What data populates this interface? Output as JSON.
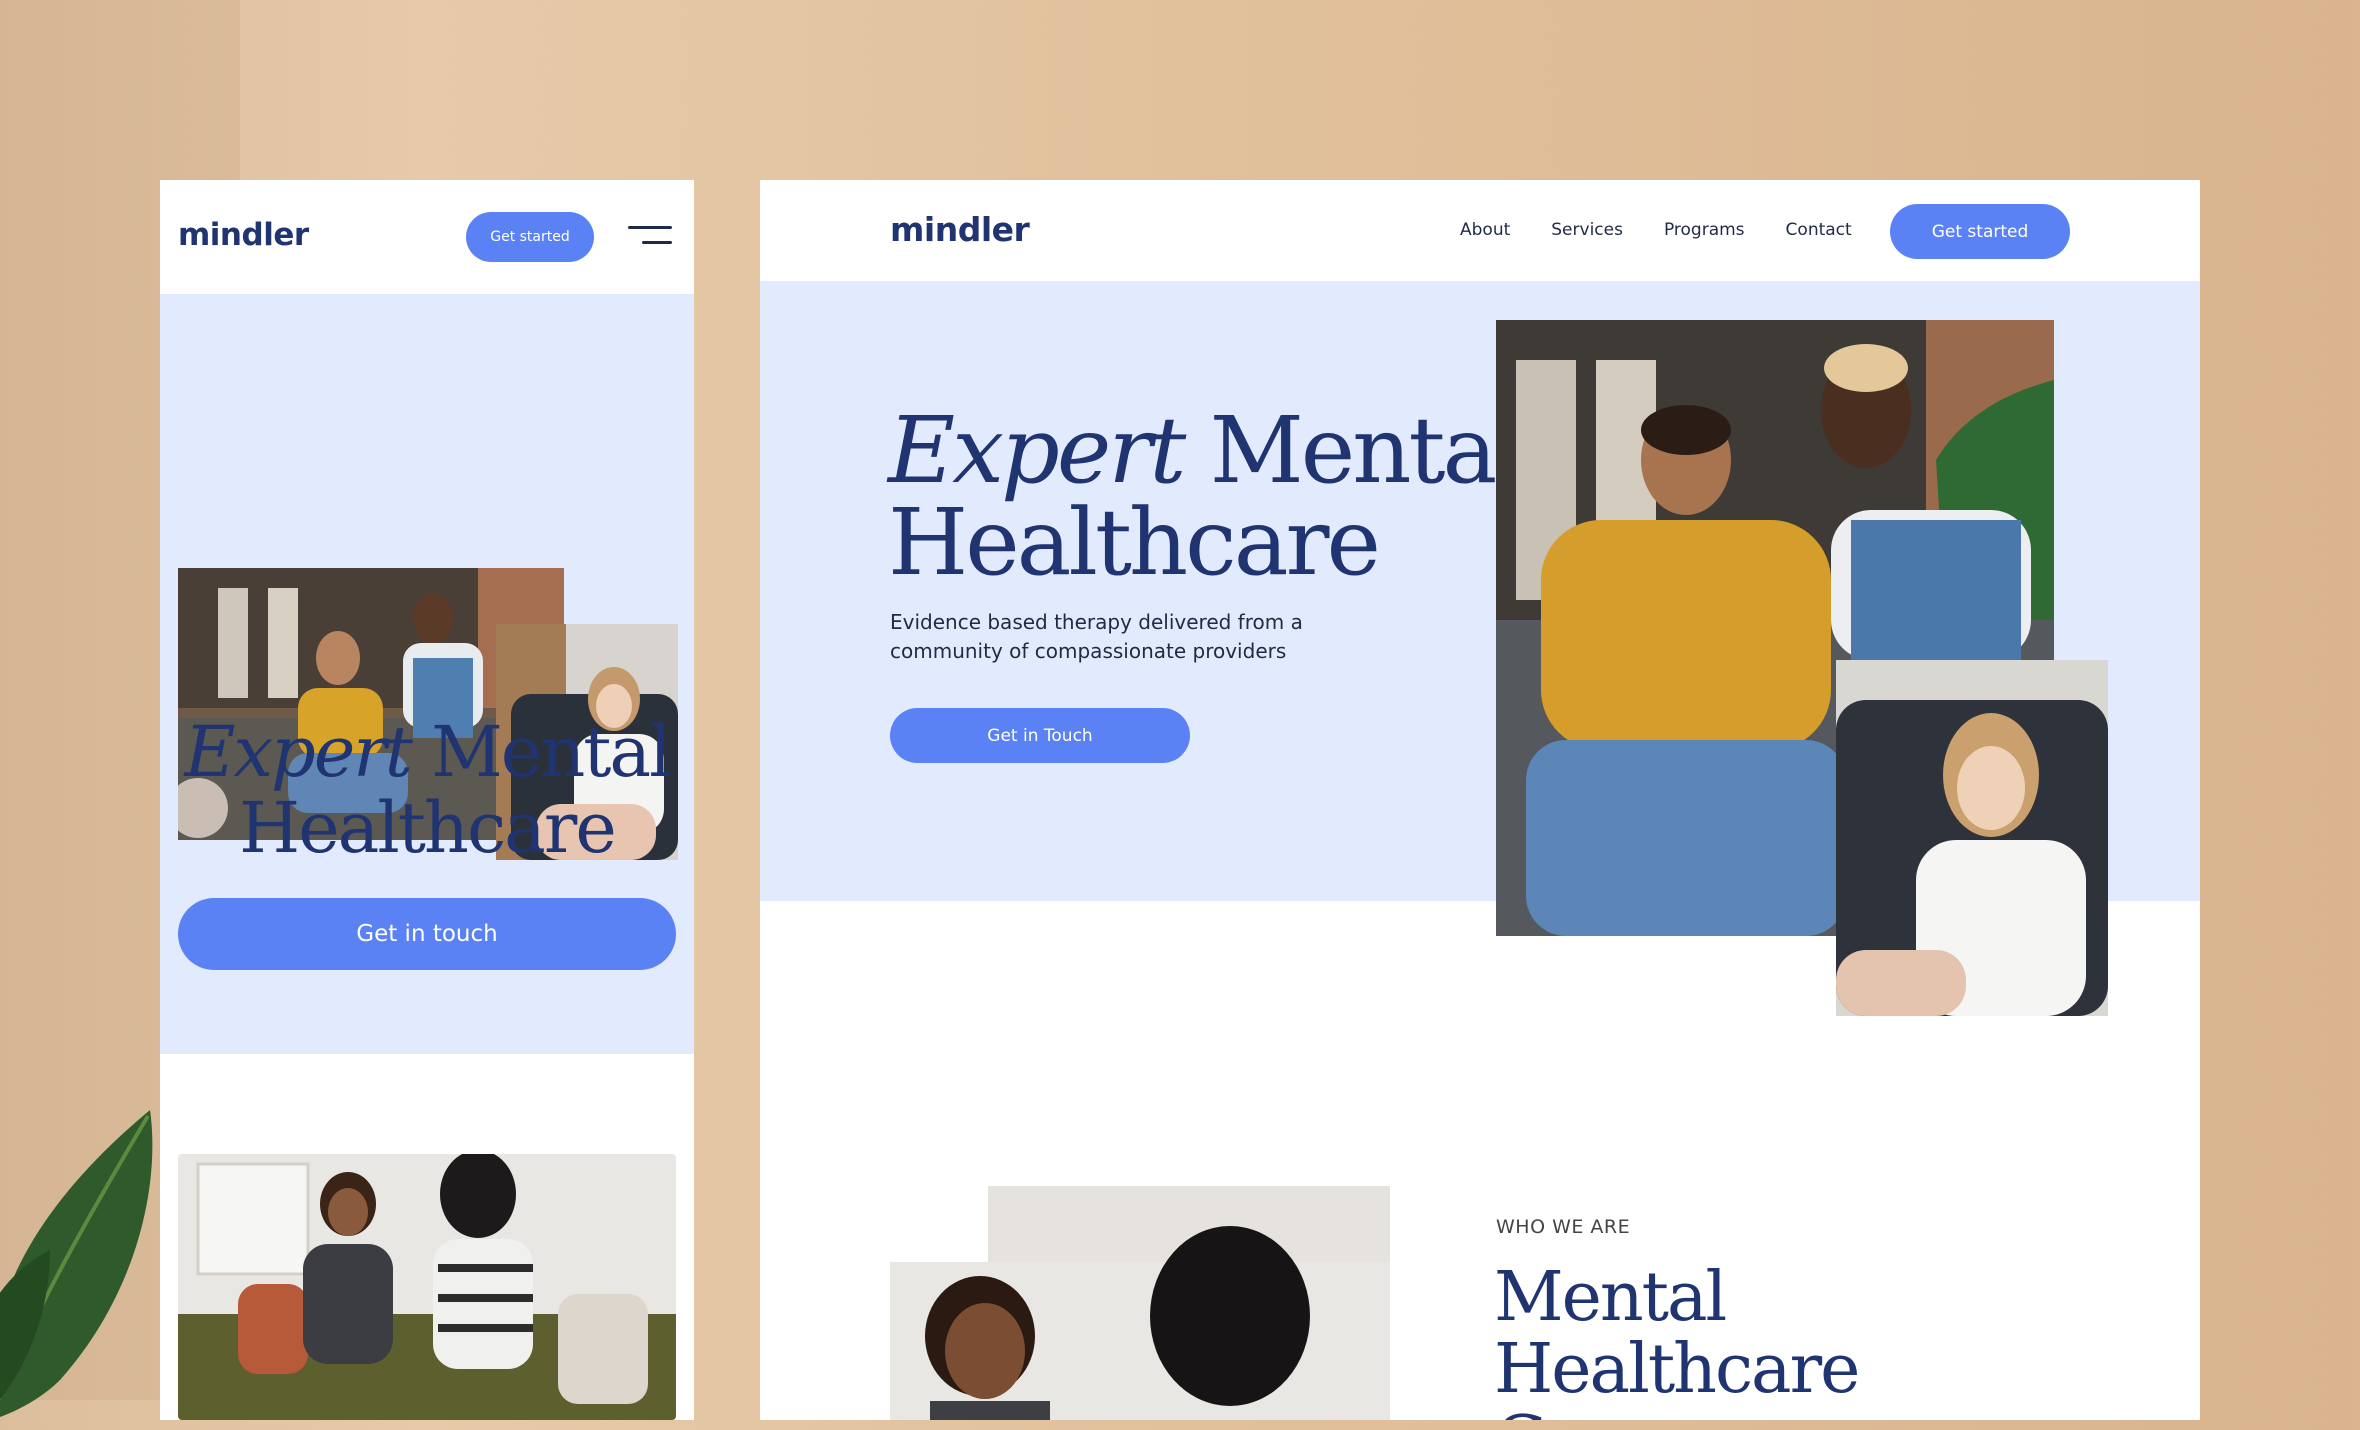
{
  "mobile": {
    "logo": "mindler",
    "get_started_label": "Get started",
    "hero": {
      "title_italic": "Expert",
      "title_rest": " Mental",
      "title_line2": "Healthcare",
      "cta_label": "Get in touch"
    }
  },
  "desktop": {
    "logo": "mindler",
    "nav": [
      "About",
      "Services",
      "Programs",
      "Contact"
    ],
    "get_started_label": "Get started",
    "hero": {
      "title_italic": "Expert",
      "title_rest": " Mental",
      "title_line2": "Healthcare",
      "subtitle": "Evidence based therapy delivered from a community of compassionate providers",
      "cta_label": "Get in Touch"
    },
    "about": {
      "eyebrow": "WHO WE ARE",
      "title": "Mental Healthcare Group"
    }
  },
  "colors": {
    "brand_navy": "#1f3470",
    "accent_blue": "#5b82f4",
    "hero_bg": "#e2ebfd"
  }
}
